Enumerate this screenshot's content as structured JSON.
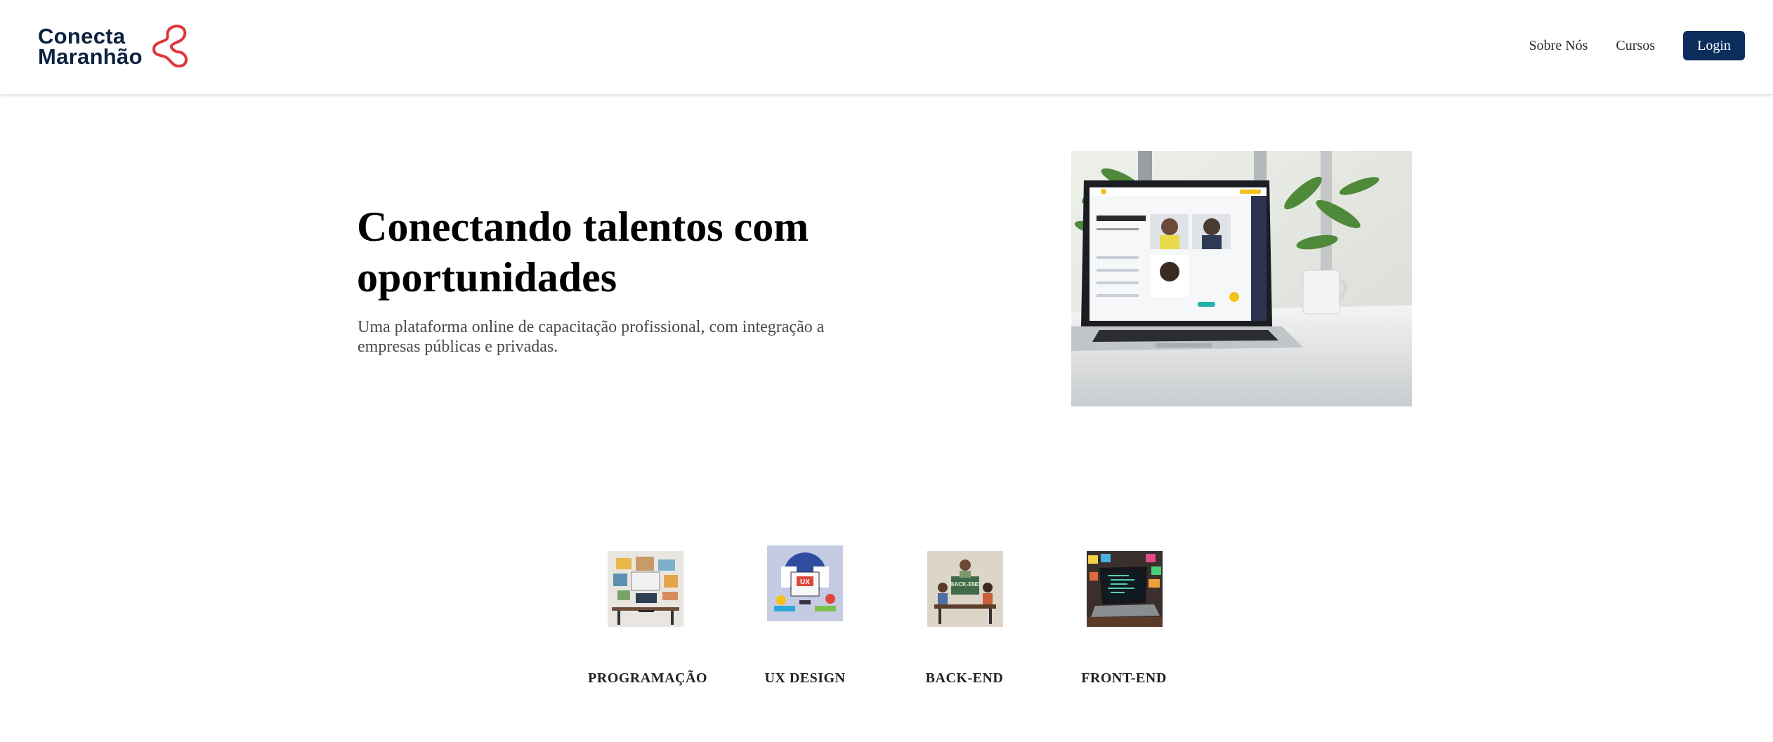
{
  "header": {
    "logo": {
      "line1": "Conecta",
      "line2": "Maranhão",
      "icon": "chain-link-logo-icon",
      "accent": "#e0353b"
    },
    "nav": {
      "about": "Sobre Nós",
      "courses": "Cursos",
      "login": "Login"
    },
    "brand_color": "#0b2d5c"
  },
  "hero": {
    "title": "Conectando talentos com oportunidades",
    "subtitle": "Uma plataforma online de capacitação profissional, com integração a empresas públicas e privadas.",
    "image_description": "laptop-on-desk-image"
  },
  "courses": [
    {
      "label": "PROGRAMAÇÃO",
      "icon": "programming-desk-image"
    },
    {
      "label": "UX DESIGN",
      "icon": "ux-design-screens-image"
    },
    {
      "label": "BACK-END",
      "icon": "back-end-team-image"
    },
    {
      "label": "FRONT-END",
      "icon": "front-end-laptop-image"
    }
  ]
}
